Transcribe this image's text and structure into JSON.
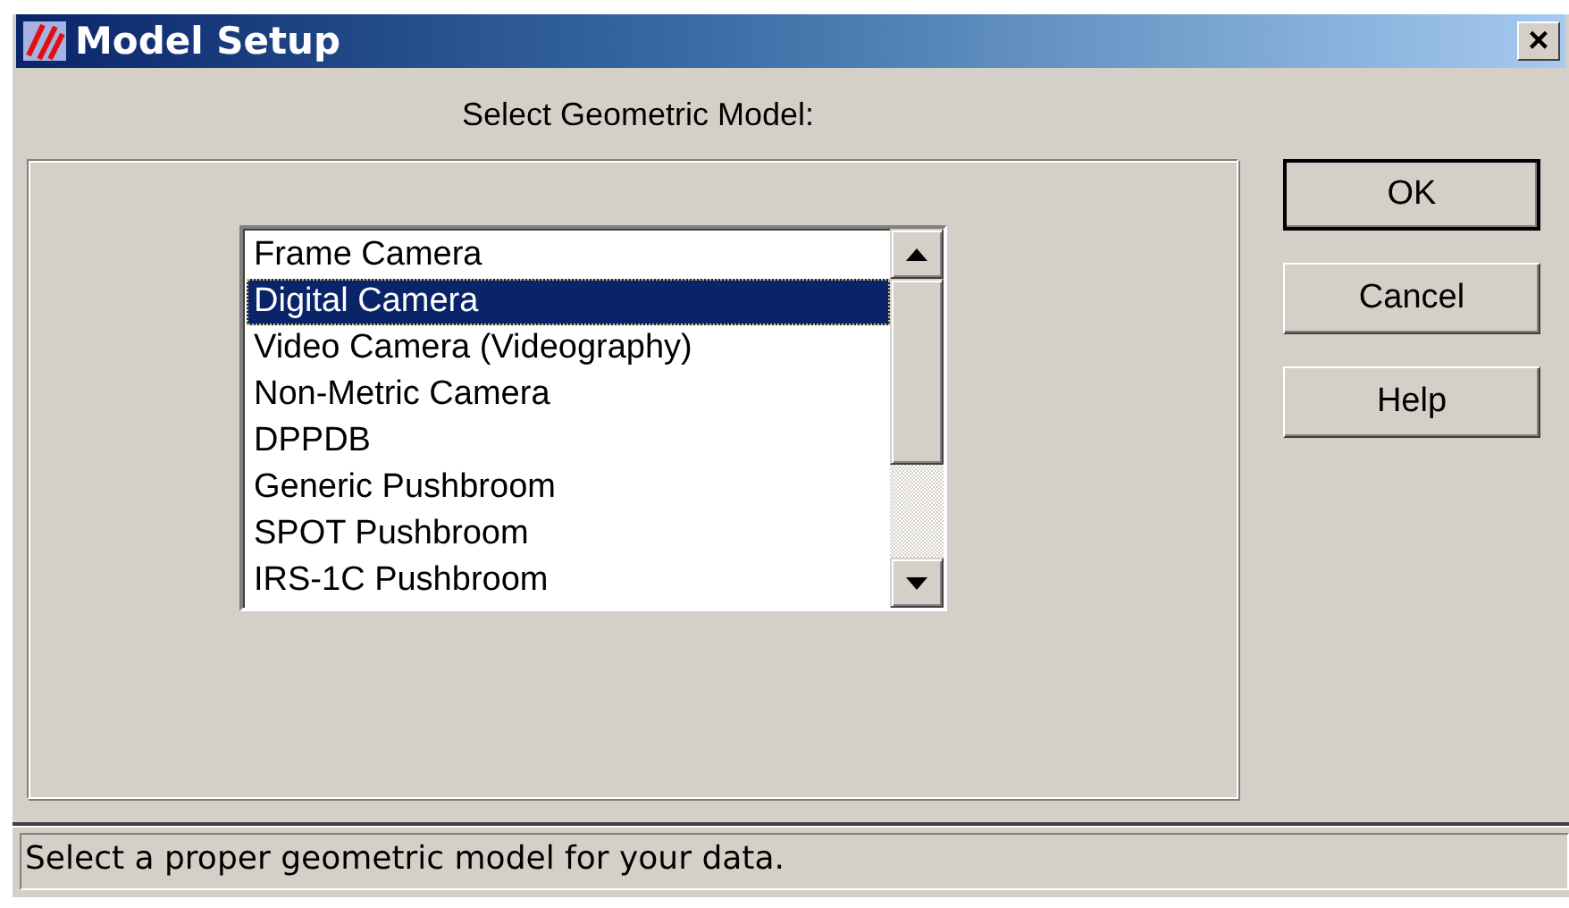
{
  "window": {
    "title": "Model Setup",
    "close": "×"
  },
  "prompt": "Select Geometric Model:",
  "list": {
    "items": [
      {
        "label": "Frame Camera",
        "selected": false
      },
      {
        "label": "Digital Camera",
        "selected": true
      },
      {
        "label": "Video Camera (Videography)",
        "selected": false
      },
      {
        "label": "Non-Metric Camera",
        "selected": false
      },
      {
        "label": "DPPDB",
        "selected": false
      },
      {
        "label": "Generic Pushbroom",
        "selected": false
      },
      {
        "label": "SPOT Pushbroom",
        "selected": false
      },
      {
        "label": "IRS-1C Pushbroom",
        "selected": false
      }
    ]
  },
  "buttons": [
    {
      "label": "OK",
      "default": true
    },
    {
      "label": "Cancel",
      "default": false
    },
    {
      "label": "Help",
      "default": false
    }
  ],
  "status_bar": "Select a proper geometric model for your data."
}
